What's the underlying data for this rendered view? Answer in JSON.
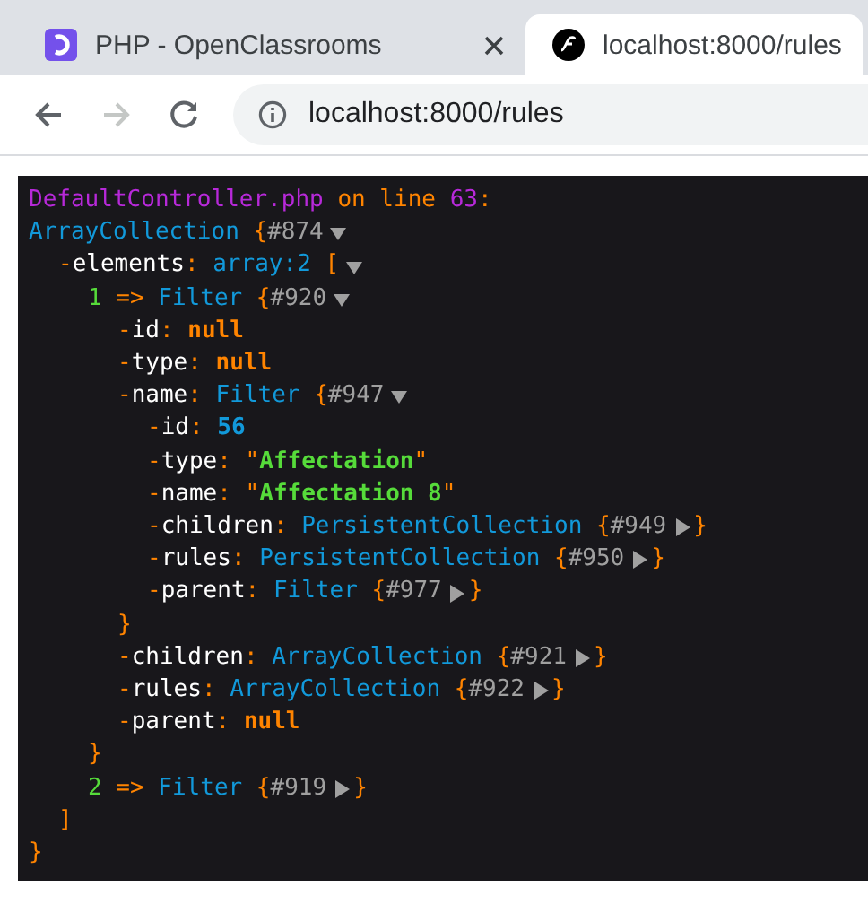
{
  "browser": {
    "tabs": [
      {
        "title": "PHP - OpenClassrooms",
        "selected": false
      },
      {
        "title": "localhost:8000/rules",
        "selected": true
      }
    ],
    "address": "localhost:8000/rules"
  },
  "dump": {
    "header": [
      {
        "kind": "file",
        "text": "DefaultController.php"
      },
      {
        "kind": "meta",
        "text": " on line "
      },
      {
        "kind": "file",
        "text": "63"
      },
      {
        "kind": "meta",
        "text": ":"
      }
    ],
    "root": {
      "parts": [
        {
          "kind": "class",
          "text": "ArrayCollection"
        },
        {
          "kind": "punct",
          "text": " {"
        },
        {
          "kind": "hash",
          "text": "#874"
        }
      ],
      "expanded": true,
      "closing": "}",
      "children": [
        {
          "parts": [
            {
              "kind": "dash",
              "text": "-"
            },
            {
              "kind": "key",
              "text": "elements"
            },
            {
              "kind": "punct",
              "text": ": "
            },
            {
              "kind": "class",
              "text": "array:2"
            },
            {
              "kind": "punct",
              "text": " ["
            }
          ],
          "expanded": true,
          "closing": "]",
          "children": [
            {
              "parts": [
                {
                  "kind": "index",
                  "text": "1"
                },
                {
                  "kind": "punct",
                  "text": " => "
                },
                {
                  "kind": "class",
                  "text": "Filter"
                },
                {
                  "kind": "punct",
                  "text": " {"
                },
                {
                  "kind": "hash",
                  "text": "#920"
                }
              ],
              "expanded": true,
              "closing": "}",
              "children": [
                {
                  "parts": [
                    {
                      "kind": "dash",
                      "text": "-"
                    },
                    {
                      "kind": "key",
                      "text": "id"
                    },
                    {
                      "kind": "punct",
                      "text": ": "
                    },
                    {
                      "kind": "null",
                      "text": "null"
                    }
                  ]
                },
                {
                  "parts": [
                    {
                      "kind": "dash",
                      "text": "-"
                    },
                    {
                      "kind": "key",
                      "text": "type"
                    },
                    {
                      "kind": "punct",
                      "text": ": "
                    },
                    {
                      "kind": "null",
                      "text": "null"
                    }
                  ]
                },
                {
                  "parts": [
                    {
                      "kind": "dash",
                      "text": "-"
                    },
                    {
                      "kind": "key",
                      "text": "name"
                    },
                    {
                      "kind": "punct",
                      "text": ": "
                    },
                    {
                      "kind": "class",
                      "text": "Filter"
                    },
                    {
                      "kind": "punct",
                      "text": " {"
                    },
                    {
                      "kind": "hash",
                      "text": "#947"
                    }
                  ],
                  "expanded": true,
                  "closing": "}",
                  "children": [
                    {
                      "parts": [
                        {
                          "kind": "dash",
                          "text": "-"
                        },
                        {
                          "kind": "key",
                          "text": "id"
                        },
                        {
                          "kind": "punct",
                          "text": ": "
                        },
                        {
                          "kind": "number",
                          "text": "56"
                        }
                      ]
                    },
                    {
                      "parts": [
                        {
                          "kind": "dash",
                          "text": "-"
                        },
                        {
                          "kind": "key",
                          "text": "type"
                        },
                        {
                          "kind": "punct",
                          "text": ": \""
                        },
                        {
                          "kind": "string",
                          "text": "Affectation"
                        },
                        {
                          "kind": "punct",
                          "text": "\""
                        }
                      ]
                    },
                    {
                      "parts": [
                        {
                          "kind": "dash",
                          "text": "-"
                        },
                        {
                          "kind": "key",
                          "text": "name"
                        },
                        {
                          "kind": "punct",
                          "text": ": \""
                        },
                        {
                          "kind": "string",
                          "text": "Affectation 8"
                        },
                        {
                          "kind": "punct",
                          "text": "\""
                        }
                      ]
                    },
                    {
                      "parts": [
                        {
                          "kind": "dash",
                          "text": "-"
                        },
                        {
                          "kind": "key",
                          "text": "children"
                        },
                        {
                          "kind": "punct",
                          "text": ": "
                        },
                        {
                          "kind": "class",
                          "text": "PersistentCollection"
                        },
                        {
                          "kind": "punct",
                          "text": " {"
                        },
                        {
                          "kind": "hash",
                          "text": "#949"
                        }
                      ],
                      "expanded": false,
                      "closing": "}"
                    },
                    {
                      "parts": [
                        {
                          "kind": "dash",
                          "text": "-"
                        },
                        {
                          "kind": "key",
                          "text": "rules"
                        },
                        {
                          "kind": "punct",
                          "text": ": "
                        },
                        {
                          "kind": "class",
                          "text": "PersistentCollection"
                        },
                        {
                          "kind": "punct",
                          "text": " {"
                        },
                        {
                          "kind": "hash",
                          "text": "#950"
                        }
                      ],
                      "expanded": false,
                      "closing": "}"
                    },
                    {
                      "parts": [
                        {
                          "kind": "dash",
                          "text": "-"
                        },
                        {
                          "kind": "key",
                          "text": "parent"
                        },
                        {
                          "kind": "punct",
                          "text": ": "
                        },
                        {
                          "kind": "class",
                          "text": "Filter"
                        },
                        {
                          "kind": "punct",
                          "text": " {"
                        },
                        {
                          "kind": "hash",
                          "text": "#977"
                        }
                      ],
                      "expanded": false,
                      "closing": "}"
                    }
                  ]
                },
                {
                  "parts": [
                    {
                      "kind": "dash",
                      "text": "-"
                    },
                    {
                      "kind": "key",
                      "text": "children"
                    },
                    {
                      "kind": "punct",
                      "text": ": "
                    },
                    {
                      "kind": "class",
                      "text": "ArrayCollection"
                    },
                    {
                      "kind": "punct",
                      "text": " {"
                    },
                    {
                      "kind": "hash",
                      "text": "#921"
                    }
                  ],
                  "expanded": false,
                  "closing": "}"
                },
                {
                  "parts": [
                    {
                      "kind": "dash",
                      "text": "-"
                    },
                    {
                      "kind": "key",
                      "text": "rules"
                    },
                    {
                      "kind": "punct",
                      "text": ": "
                    },
                    {
                      "kind": "class",
                      "text": "ArrayCollection"
                    },
                    {
                      "kind": "punct",
                      "text": " {"
                    },
                    {
                      "kind": "hash",
                      "text": "#922"
                    }
                  ],
                  "expanded": false,
                  "closing": "}"
                },
                {
                  "parts": [
                    {
                      "kind": "dash",
                      "text": "-"
                    },
                    {
                      "kind": "key",
                      "text": "parent"
                    },
                    {
                      "kind": "punct",
                      "text": ": "
                    },
                    {
                      "kind": "null",
                      "text": "null"
                    }
                  ]
                }
              ]
            },
            {
              "parts": [
                {
                  "kind": "index",
                  "text": "2"
                },
                {
                  "kind": "punct",
                  "text": " => "
                },
                {
                  "kind": "class",
                  "text": "Filter"
                },
                {
                  "kind": "punct",
                  "text": " {"
                },
                {
                  "kind": "hash",
                  "text": "#919"
                }
              ],
              "expanded": false,
              "closing": "}"
            }
          ]
        }
      ]
    }
  }
}
